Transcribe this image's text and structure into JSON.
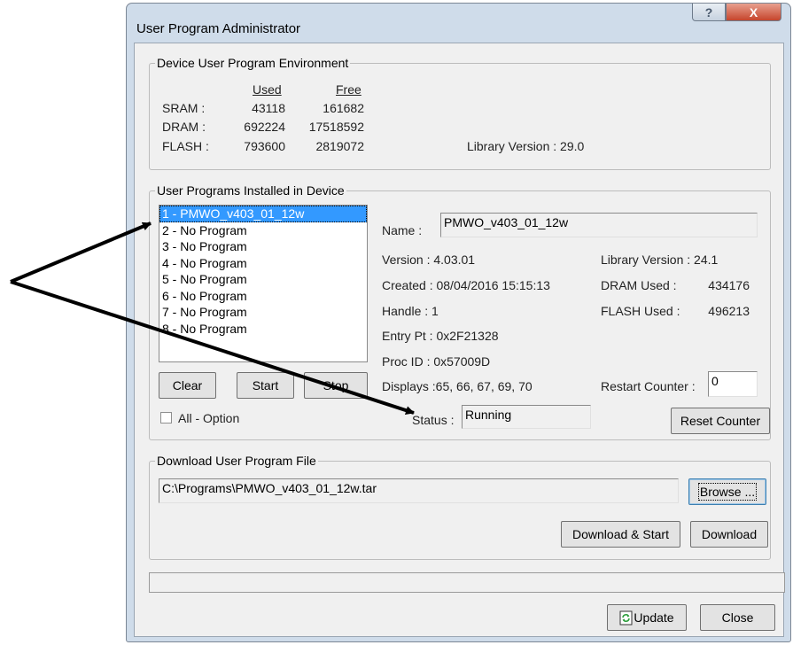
{
  "window": {
    "title": "User Program Administrator",
    "help_label": "?",
    "close_label": "X"
  },
  "env": {
    "legend": "Device User Program Environment",
    "col_used": "Used",
    "col_free": "Free",
    "rows": [
      {
        "label": "SRAM :",
        "used": "43118",
        "free": "161682"
      },
      {
        "label": "DRAM :",
        "used": "692224",
        "free": "17518592"
      },
      {
        "label": "FLASH :",
        "used": "793600",
        "free": "2819072"
      }
    ],
    "library_version": "Library Version : 29.0"
  },
  "installed": {
    "legend": "User Programs Installed in Device",
    "programs": [
      "1 - PMWO_v403_01_12w",
      "2 - No Program",
      "3 - No Program",
      "4 - No Program",
      "5 - No Program",
      "6 - No Program",
      "7 - No Program",
      "8 - No Program"
    ],
    "selected_index": 0,
    "buttons": {
      "clear": "Clear",
      "start": "Start",
      "stop": "Stop"
    },
    "all_option_label": "All - Option",
    "all_option_checked": false,
    "name_label": "Name :",
    "name_value": "PMWO_v403_01_12w",
    "version": "Version : 4.03.01",
    "created": "Created : 08/04/2016 15:15:13",
    "handle": "Handle : 1",
    "entry_pt": "Entry Pt : 0x2F21328",
    "proc_id": "Proc ID : 0x57009D",
    "displays": "Displays :65, 66, 67, 69, 70",
    "status_label": "Status :",
    "status_value": "Running",
    "library_version": "Library Version : 24.1",
    "dram_used_label": "DRAM Used :",
    "dram_used_value": "434176",
    "flash_used_label": "FLASH Used :",
    "flash_used_value": "496213",
    "restart_counter_label": "Restart Counter :",
    "restart_counter_value": "0",
    "reset_counter_label": "Reset Counter"
  },
  "download": {
    "legend": "Download User Program File",
    "path": "C:\\Programs\\PMWO_v403_01_12w.tar",
    "browse_label": "Browse ...",
    "download_start_label": "Download & Start",
    "download_label": "Download"
  },
  "footer": {
    "update_label": "Update",
    "close_label": "Close"
  },
  "colors": {
    "selection": "#3399ff",
    "frame": "#cfdcea",
    "close_button": "#c6452c"
  }
}
